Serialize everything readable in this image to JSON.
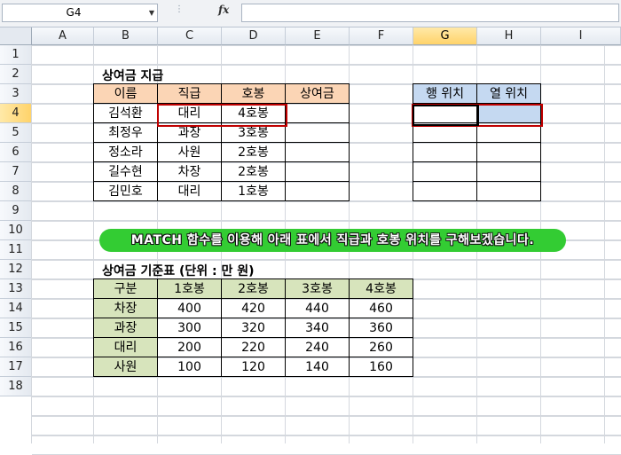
{
  "formula_bar": {
    "name_box": "G4",
    "fx_label": "fx",
    "formula": ""
  },
  "columns": [
    "A",
    "B",
    "C",
    "D",
    "E",
    "F",
    "G",
    "H",
    "I"
  ],
  "rows": [
    "1",
    "2",
    "3",
    "4",
    "5",
    "6",
    "7",
    "8",
    "9",
    "10",
    "11",
    "12",
    "13",
    "14",
    "15",
    "16",
    "17",
    "18"
  ],
  "active_cell": "G4",
  "bonus_table": {
    "title": "상여금 지급",
    "headers": [
      "이름",
      "직급",
      "호봉",
      "상여금"
    ],
    "rows": [
      [
        "김석환",
        "대리",
        "4호봉",
        ""
      ],
      [
        "최정우",
        "과장",
        "3호봉",
        ""
      ],
      [
        "정소라",
        "사원",
        "2호봉",
        ""
      ],
      [
        "길수현",
        "차장",
        "2호봉",
        ""
      ],
      [
        "김민호",
        "대리",
        "1호봉",
        ""
      ]
    ]
  },
  "position_table": {
    "headers": [
      "행 위치",
      "열 위치"
    ]
  },
  "banner_text": "MATCH 함수를 이용해 아래 표에서 직급과 호봉 위치를 구해보겠습니다.",
  "standard_table": {
    "title": "상여금 기준표 (단위 : 만 원)",
    "headers": [
      "구분",
      "1호봉",
      "2호봉",
      "3호봉",
      "4호봉"
    ],
    "rows": [
      [
        "차장",
        "400",
        "420",
        "440",
        "460"
      ],
      [
        "과장",
        "300",
        "320",
        "340",
        "360"
      ],
      [
        "대리",
        "200",
        "220",
        "240",
        "260"
      ],
      [
        "사원",
        "100",
        "120",
        "140",
        "160"
      ]
    ]
  },
  "colors": {
    "orange_header": "#fbd5b5",
    "blue_header": "#c5d9f1",
    "green_header": "#d7e4bc",
    "highlight_red": "#c00000",
    "banner_green": "#33cc33",
    "selected_fill": "#c5d9f1"
  }
}
